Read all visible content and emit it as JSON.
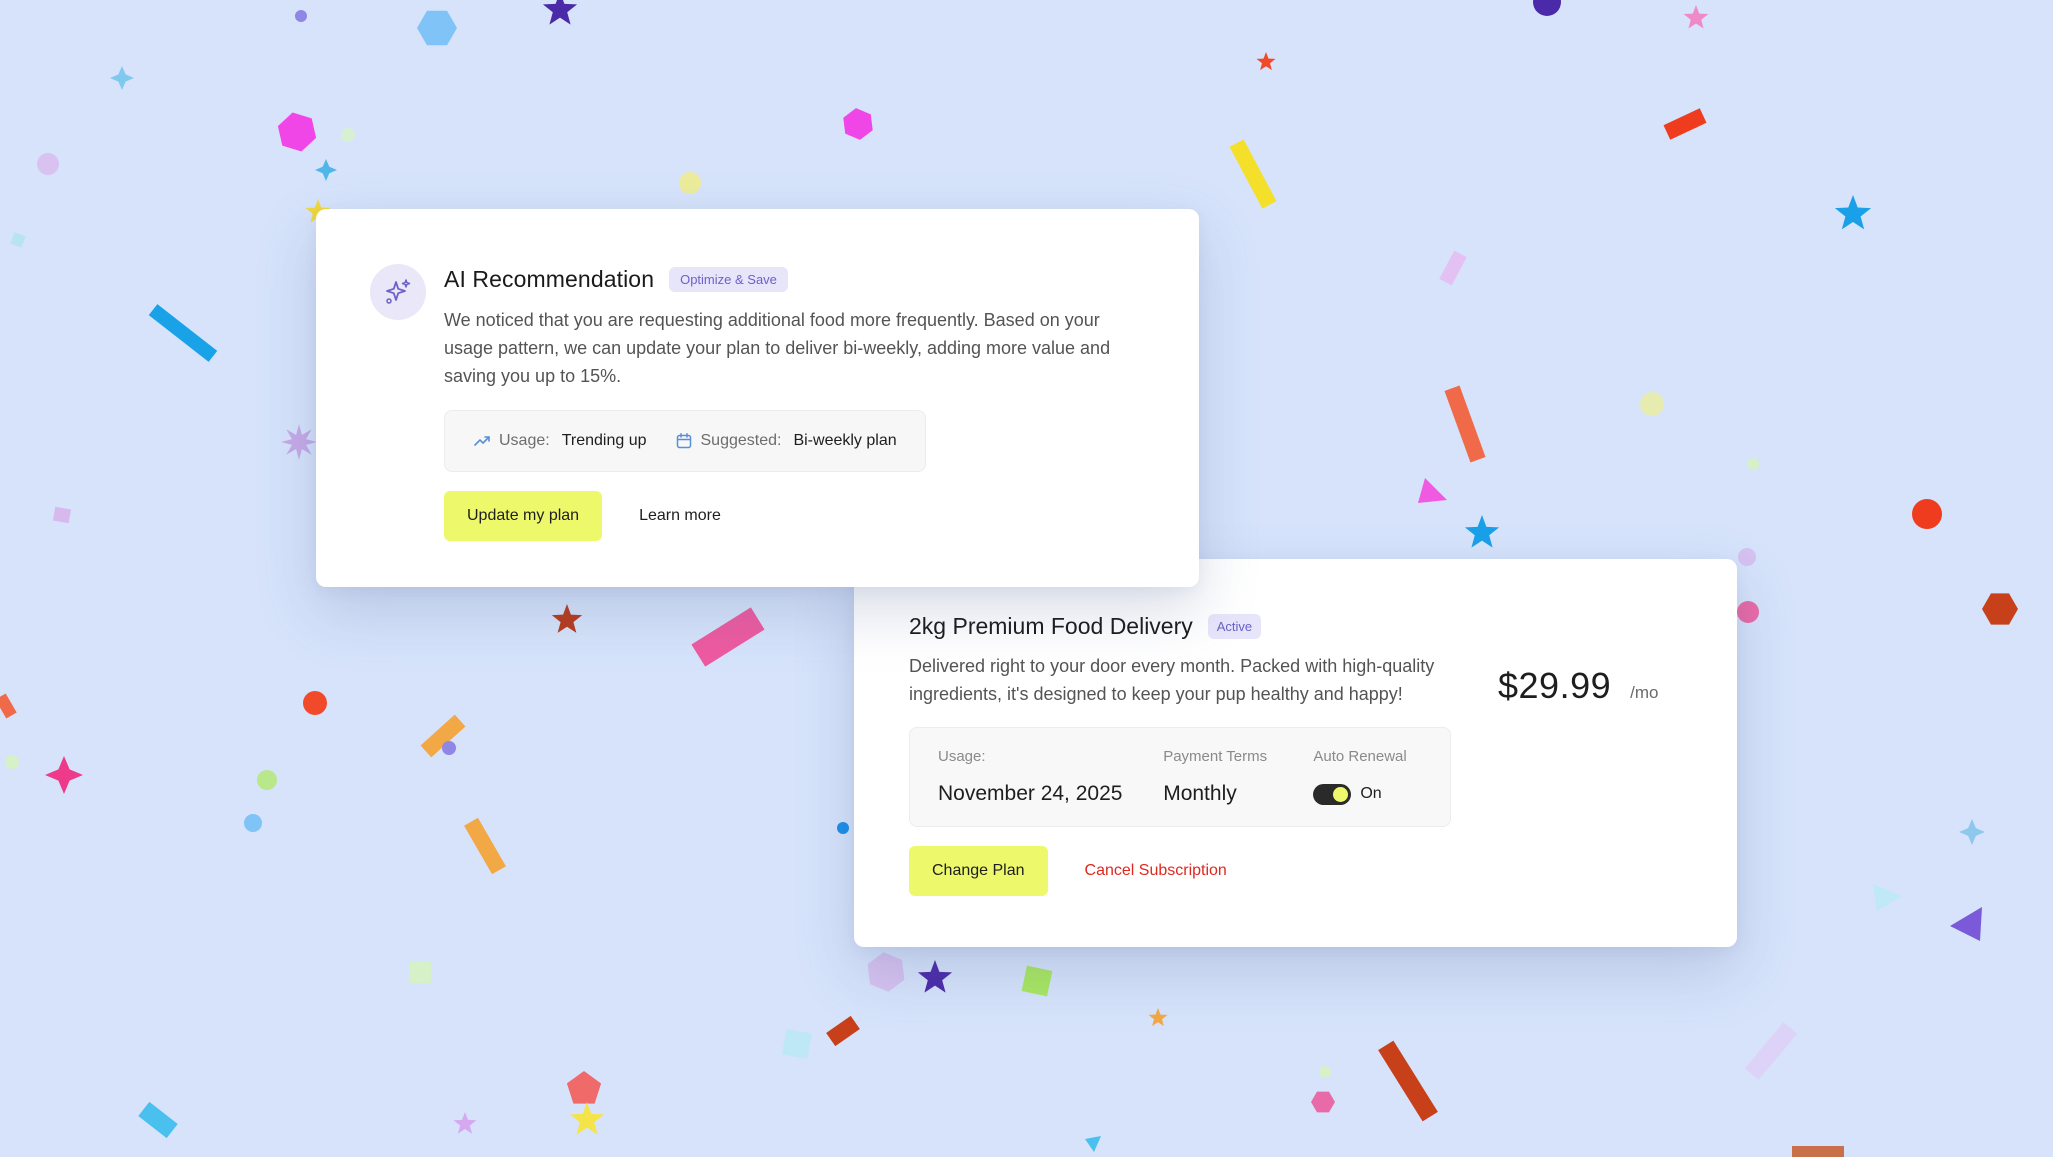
{
  "ai_card": {
    "title": "AI Recommendation",
    "badge": "Optimize & Save",
    "icon": "sparkles-icon",
    "description": "We noticed that you are requesting additional food more frequently. Based on your usage pattern, we can update your plan to deliver bi-weekly, adding more value and saving you up to 15%.",
    "usage_label": "Usage:",
    "usage_value": "Trending up",
    "suggested_label": "Suggested:",
    "suggested_value": "Bi-weekly plan",
    "update_button": "Update my plan",
    "learn_more": "Learn more"
  },
  "subscription": {
    "title": "2kg Premium Food Delivery",
    "status_badge": "Active",
    "description": "Delivered right to your door every month. Packed with high-quality ingredients, it's designed to keep your pup healthy and happy!",
    "price": "$29.99",
    "per": "/mo",
    "usage_label": "Usage:",
    "usage_value": "November 24, 2025",
    "terms_label": "Payment Terms",
    "terms_value": "Monthly",
    "renewal_label": "Auto Renewal",
    "renewal_value": "On",
    "renewal_enabled": true,
    "change_button": "Change Plan",
    "cancel_button": "Cancel Subscription"
  },
  "colors": {
    "background": "#d6e3fb",
    "accent_button": "#eef86b",
    "badge_bg": "#e7e5fa",
    "badge_text": "#6b62c9",
    "danger": "#e0281f"
  }
}
